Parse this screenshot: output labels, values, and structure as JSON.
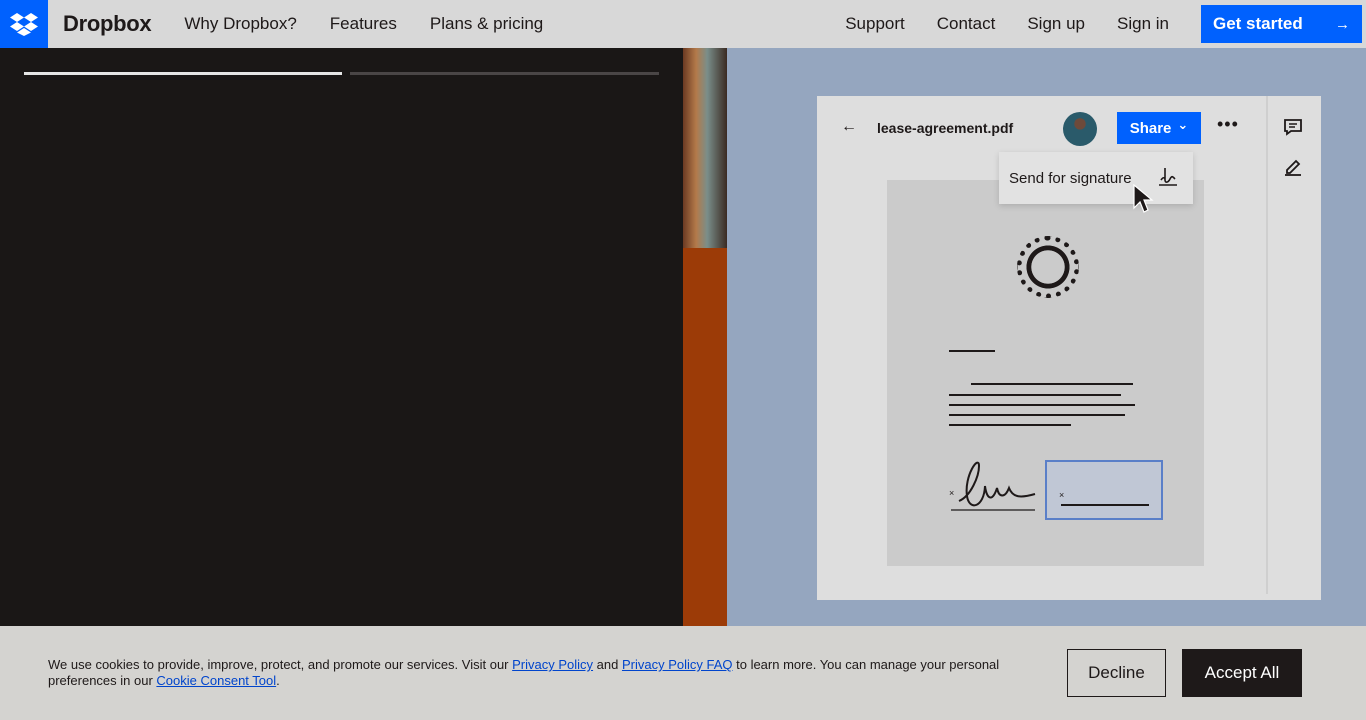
{
  "header": {
    "brand": "Dropbox",
    "nav_left": [
      "Why Dropbox?",
      "Features",
      "Plans & pricing"
    ],
    "nav_right": [
      "Support",
      "Contact",
      "Sign up",
      "Sign in"
    ],
    "cta_label": "Get started",
    "cta_arrow": "→"
  },
  "video": {
    "progress_segments": [
      1.0,
      0.0
    ]
  },
  "preview": {
    "back_glyph": "←",
    "filename": "lease-agreement.pdf",
    "share_label": "Share",
    "share_chevron": "⌄",
    "more_glyph": "•••",
    "dropdown_label": "Send for signature",
    "icons": [
      "back-arrow-icon",
      "avatar",
      "chevron-down-icon",
      "more-icon",
      "comment-icon",
      "pencil-icon",
      "signature-icon",
      "cursor-icon",
      "seal-icon"
    ]
  },
  "cookie": {
    "text_1": "We use cookies to provide, improve, protect, and promote our services. Visit our ",
    "link_privacy": "Privacy Policy",
    "text_2": " and ",
    "link_faq": "Privacy Policy FAQ",
    "text_3": " to learn more. You can manage your personal preferences in our ",
    "link_tool": "Cookie Consent Tool",
    "text_4": ".",
    "decline_label": "Decline",
    "accept_label": "Accept All"
  },
  "colors": {
    "brand_blue": "#0061fe",
    "header_bg": "#d8d8d8",
    "preview_bg": "#95a6bf",
    "dark_panel": "#1a1716",
    "accent_strip": "#9c3b07"
  }
}
